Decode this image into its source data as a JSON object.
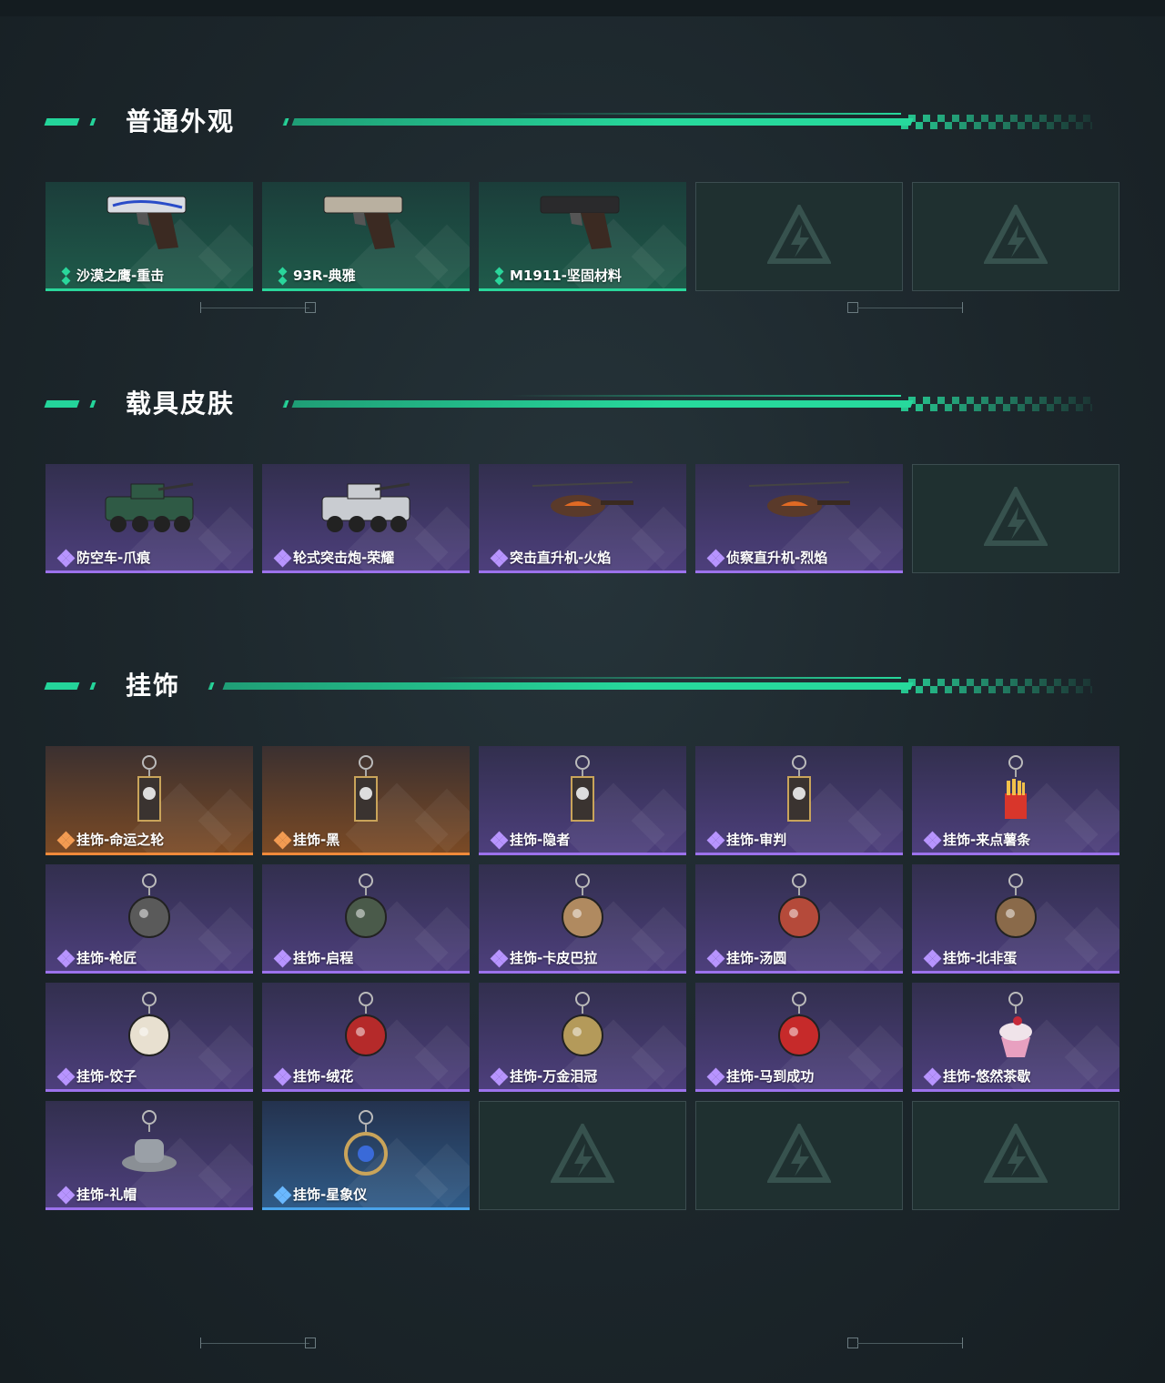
{
  "sections": [
    {
      "title": "普通外观",
      "items": [
        {
          "label": "沙漠之鹰-重击",
          "rarity": "green",
          "art": "pistol-deagle-icon"
        },
        {
          "label": "93R-典雅",
          "rarity": "green",
          "art": "pistol-93r-icon"
        },
        {
          "label": "M1911-坚固材料",
          "rarity": "green",
          "art": "pistol-m1911-icon"
        },
        {
          "label": "",
          "rarity": "empty"
        },
        {
          "label": "",
          "rarity": "empty"
        }
      ]
    },
    {
      "title": "载具皮肤",
      "items": [
        {
          "label": "防空车-爪痕",
          "rarity": "purple",
          "art": "armored-vehicle-icon"
        },
        {
          "label": "轮式突击炮-荣耀",
          "rarity": "purple",
          "art": "assault-gun-vehicle-icon"
        },
        {
          "label": "突击直升机-火焰",
          "rarity": "purple",
          "art": "attack-helicopter-icon"
        },
        {
          "label": "侦察直升机-烈焰",
          "rarity": "purple",
          "art": "scout-helicopter-icon"
        },
        {
          "label": "",
          "rarity": "empty"
        }
      ]
    },
    {
      "title": "挂饰",
      "items": [
        {
          "label": "挂饰-命运之轮",
          "rarity": "orange",
          "art": "tarot-card-charm-icon"
        },
        {
          "label": "挂饰-黑",
          "rarity": "orange",
          "art": "tag-charm-icon"
        },
        {
          "label": "挂饰-隐者",
          "rarity": "purple",
          "art": "tarot-card-charm-icon"
        },
        {
          "label": "挂饰-审判",
          "rarity": "purple",
          "art": "tarot-card-charm-icon"
        },
        {
          "label": "挂饰-来点薯条",
          "rarity": "purple",
          "art": "fries-charm-icon"
        },
        {
          "label": "挂饰-枪匠",
          "rarity": "purple",
          "art": "gun-parts-charm-icon"
        },
        {
          "label": "挂饰-启程",
          "rarity": "purple",
          "art": "round-badge-charm-icon"
        },
        {
          "label": "挂饰-卡皮巴拉",
          "rarity": "purple",
          "art": "capybara-charm-icon"
        },
        {
          "label": "挂饰-汤圆",
          "rarity": "purple",
          "art": "bowl-charm-icon"
        },
        {
          "label": "挂饰-北非蛋",
          "rarity": "purple",
          "art": "pan-charm-icon"
        },
        {
          "label": "挂饰-饺子",
          "rarity": "purple",
          "art": "dumpling-charm-icon"
        },
        {
          "label": "挂饰-绒花",
          "rarity": "purple",
          "art": "flower-charm-icon"
        },
        {
          "label": "挂饰-万金泪冠",
          "rarity": "purple",
          "art": "burger-charm-icon"
        },
        {
          "label": "挂饰-马到成功",
          "rarity": "purple",
          "art": "horse-charm-icon"
        },
        {
          "label": "挂饰-悠然茶歇",
          "rarity": "purple",
          "art": "cupcake-charm-icon"
        },
        {
          "label": "挂饰-礼帽",
          "rarity": "purple",
          "art": "hat-charm-icon"
        },
        {
          "label": "挂饰-星象仪",
          "rarity": "blue",
          "art": "orrery-charm-icon"
        },
        {
          "label": "",
          "rarity": "empty"
        },
        {
          "label": "",
          "rarity": "empty"
        },
        {
          "label": "",
          "rarity": "empty"
        }
      ]
    }
  ],
  "colors": {
    "accent": "#27d99c",
    "purple": "#9c72ec",
    "orange": "#f08a3a",
    "blue": "#4aa3ea"
  }
}
